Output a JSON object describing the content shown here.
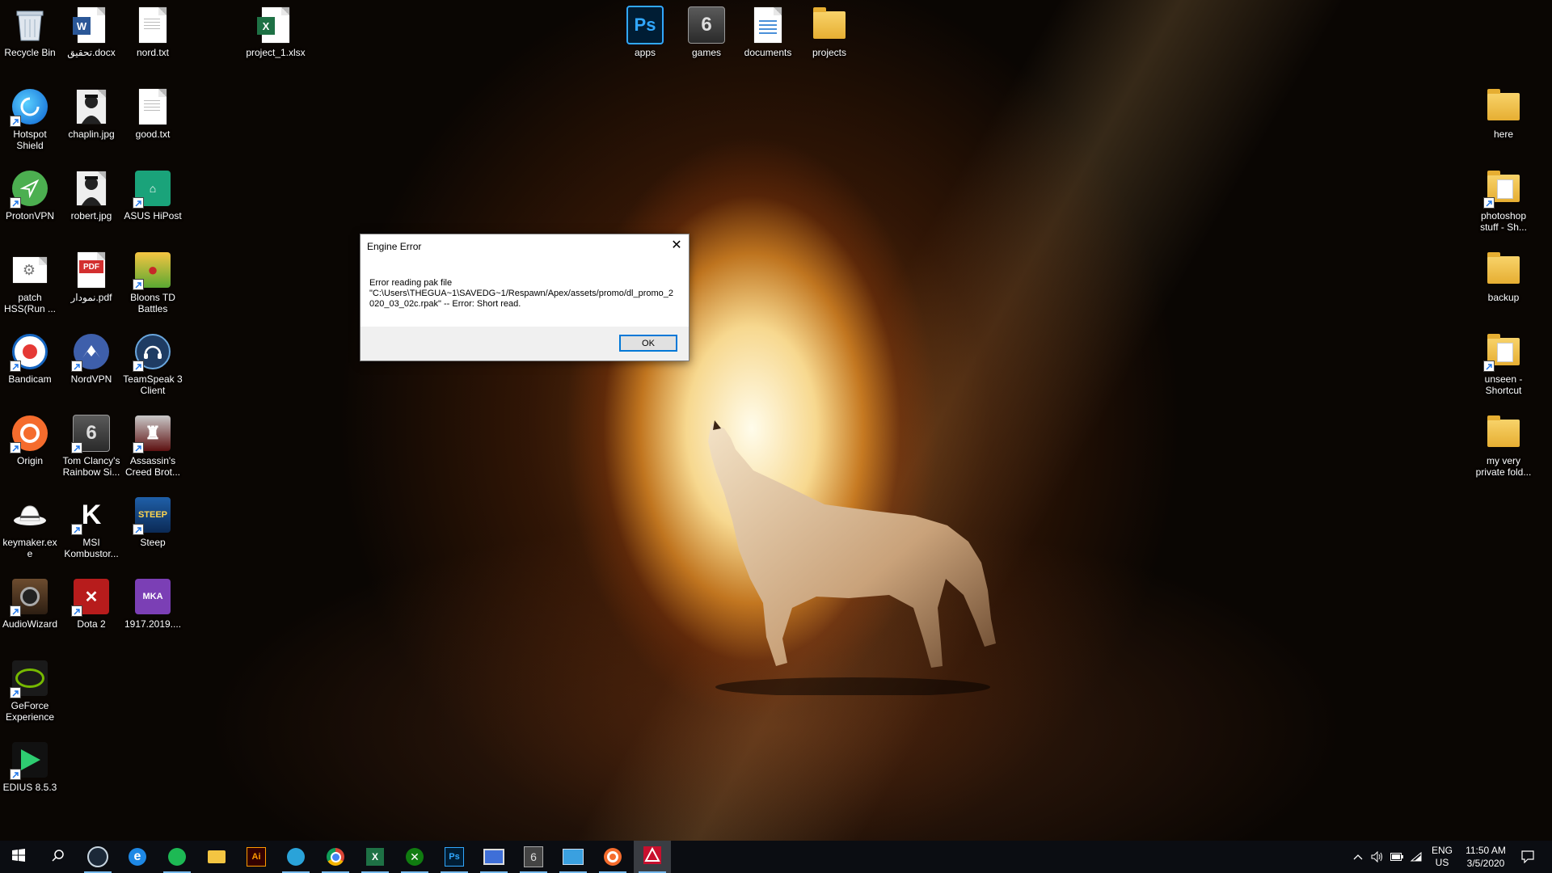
{
  "desktop": {
    "icons_left": [
      {
        "label": "Recycle Bin",
        "icon": "recycle-bin-icon"
      },
      {
        "label": "تحقیق.docx",
        "icon": "word-document-icon"
      },
      {
        "label": "nord.txt",
        "icon": "text-file-icon"
      },
      {
        "label": "project_1.xlsx",
        "icon": "excel-file-icon"
      },
      {
        "label": "Hotspot Shield",
        "icon": "hotspot-shield-icon"
      },
      {
        "label": "chaplin.jpg",
        "icon": "image-file-icon"
      },
      {
        "label": "good.txt",
        "icon": "text-file-icon"
      },
      {
        "label": "ProtonVPN",
        "icon": "protonvpn-icon"
      },
      {
        "label": "robert.jpg",
        "icon": "image-file-icon"
      },
      {
        "label": "ASUS HiPost",
        "icon": "asus-hipost-icon"
      },
      {
        "label": "patch HSS(Run ...",
        "icon": "settings-file-icon"
      },
      {
        "label": "نمودار.pdf",
        "icon": "pdf-file-icon"
      },
      {
        "label": "Bloons TD Battles",
        "icon": "bloons-td-icon"
      },
      {
        "label": "Bandicam",
        "icon": "bandicam-icon"
      },
      {
        "label": "NordVPN",
        "icon": "nordvpn-icon"
      },
      {
        "label": "TeamSpeak 3 Client",
        "icon": "teamspeak-icon"
      },
      {
        "label": "Origin",
        "icon": "origin-icon"
      },
      {
        "label": "Tom Clancy's Rainbow Si...",
        "icon": "rainbow-six-icon"
      },
      {
        "label": "Assassin's Creed Brot...",
        "icon": "assassins-creed-icon"
      },
      {
        "label": "keymaker.exe",
        "icon": "keymaker-icon"
      },
      {
        "label": "MSI Kombustor...",
        "icon": "msi-kombustor-icon"
      },
      {
        "label": "Steep",
        "icon": "steep-icon"
      },
      {
        "label": "AudioWizard",
        "icon": "audiowizard-icon"
      },
      {
        "label": "Dota 2",
        "icon": "dota2-icon"
      },
      {
        "label": "1917.2019....",
        "icon": "mka-video-icon"
      },
      {
        "label": "GeForce Experience",
        "icon": "geforce-icon"
      },
      {
        "label": "EDIUS 8.5.3",
        "icon": "edius-icon"
      }
    ],
    "icons_top": [
      {
        "label": "apps",
        "icon": "photoshop-folder-icon"
      },
      {
        "label": "games",
        "icon": "rainbow-six-folder-icon"
      },
      {
        "label": "documents",
        "icon": "documents-icon"
      },
      {
        "label": "projects",
        "icon": "folder-icon"
      }
    ],
    "icons_right": [
      {
        "label": "here",
        "icon": "folder-icon"
      },
      {
        "label": "photoshop stuff - Sh...",
        "icon": "folder-shortcut-icon"
      },
      {
        "label": "backup",
        "icon": "folder-icon"
      },
      {
        "label": "unseen - Shortcut",
        "icon": "folder-shortcut-icon"
      },
      {
        "label": "my very private fold...",
        "icon": "folder-icon"
      }
    ]
  },
  "dialog": {
    "title": "Engine Error",
    "message_line1": "Error reading pak file",
    "message_line2": "\"C:\\Users\\THEGUA~1\\SAVEDG~1/Respawn/Apex/assets/promo/dl_promo_2020_03_02c.rpak\" -- Error: Short read.",
    "ok_label": "OK",
    "close_glyph": "✕"
  },
  "taskbar": {
    "apps": [
      "start",
      "search",
      "steam",
      "edge",
      "spotify",
      "file-explorer",
      "illustrator",
      "telegram",
      "chrome",
      "excel",
      "xbox",
      "photoshop",
      "remote-desktop",
      "rainbow-six",
      "control-panel",
      "origin",
      "apex-legends"
    ],
    "active_app": "apex-legends",
    "language": "ENG",
    "region": "US",
    "time": "11:50 AM",
    "date": "3/5/2020"
  }
}
